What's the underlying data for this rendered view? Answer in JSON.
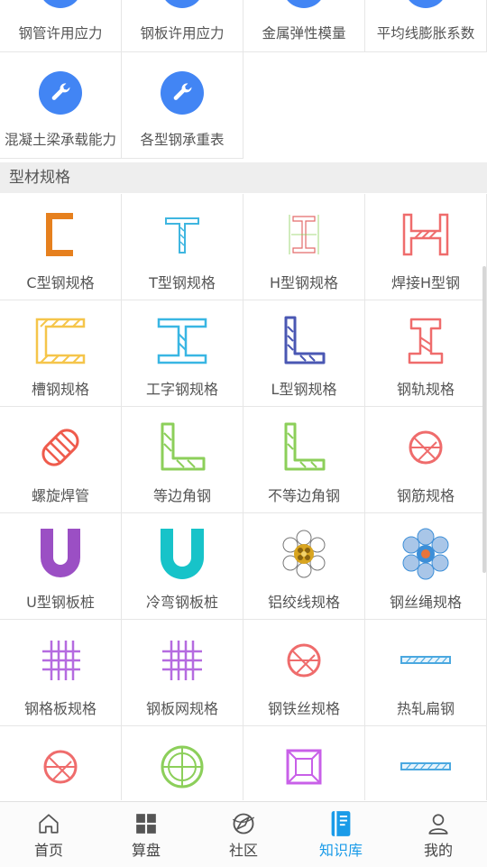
{
  "top_tools": [
    {
      "label": "钢管许用应力",
      "icon": "wrench-icon"
    },
    {
      "label": "钢板许用应力",
      "icon": "wrench-icon"
    },
    {
      "label": "金属弹性模量",
      "icon": "wrench-icon"
    },
    {
      "label": "平均线膨胀系数",
      "icon": "wrench-icon"
    },
    {
      "label": "混凝土梁承载能力",
      "icon": "wrench-icon"
    },
    {
      "label": "各型钢承重表",
      "icon": "wrench-icon"
    }
  ],
  "section": {
    "title": "型材规格"
  },
  "profiles": [
    {
      "label": "C型钢规格",
      "icon": "c-channel-icon",
      "color": "#e6801e"
    },
    {
      "label": "T型钢规格",
      "icon": "t-beam-icon",
      "color": "#3fb6e0"
    },
    {
      "label": "H型钢规格",
      "icon": "h-beam-drawing-icon",
      "color": "#e36b6b"
    },
    {
      "label": "焊接H型钢",
      "icon": "welded-h-beam-icon",
      "color": "#ef6c6c"
    },
    {
      "label": "槽钢规格",
      "icon": "channel-steel-icon",
      "color": "#f5c54a"
    },
    {
      "label": "工字钢规格",
      "icon": "i-beam-icon",
      "color": "#39b6e3"
    },
    {
      "label": "L型钢规格",
      "icon": "l-angle-icon",
      "color": "#4a57b3"
    },
    {
      "label": "钢轨规格",
      "icon": "rail-icon",
      "color": "#ef6c6c"
    },
    {
      "label": "螺旋焊管",
      "icon": "spiral-pipe-icon",
      "color": "#ef5b4c"
    },
    {
      "label": "等边角钢",
      "icon": "equal-angle-icon",
      "color": "#8ccf5a"
    },
    {
      "label": "不等边角钢",
      "icon": "unequal-angle-icon",
      "color": "#8ccf5a"
    },
    {
      "label": "钢筋规格",
      "icon": "rebar-icon",
      "color": "#ef6c6c"
    },
    {
      "label": "U型钢板桩",
      "icon": "u-sheet-pile-icon",
      "color": "#9b4fc4"
    },
    {
      "label": "冷弯钢板桩",
      "icon": "cold-formed-pile-icon",
      "color": "#17c3c9"
    },
    {
      "label": "铝绞线规格",
      "icon": "aluminum-strand-icon",
      "color": "#d9a520"
    },
    {
      "label": "钢丝绳规格",
      "icon": "wire-rope-icon",
      "color": "#3d8fd8"
    },
    {
      "label": "钢格板规格",
      "icon": "grating-icon",
      "color": "#b56be0"
    },
    {
      "label": "钢板网规格",
      "icon": "mesh-icon",
      "color": "#b56be0"
    },
    {
      "label": "钢铁丝规格",
      "icon": "steel-wire-icon",
      "color": "#ef6c6c"
    },
    {
      "label": "热轧扁钢",
      "icon": "flat-bar-icon",
      "color": "#4aa8e0"
    },
    {
      "label": "",
      "icon": "round-bar-icon",
      "color": "#ef6c6c"
    },
    {
      "label": "",
      "icon": "round-pipe-icon",
      "color": "#8ccf5a"
    },
    {
      "label": "",
      "icon": "square-pipe-icon",
      "color": "#c860e8"
    },
    {
      "label": "",
      "icon": "flat-strip-icon",
      "color": "#4aa8e0"
    }
  ],
  "tabs": [
    {
      "label": "首页",
      "icon": "home-icon",
      "active": false
    },
    {
      "label": "算盘",
      "icon": "grid-icon",
      "active": false
    },
    {
      "label": "社区",
      "icon": "compass-icon",
      "active": false
    },
    {
      "label": "知识库",
      "icon": "book-icon",
      "active": true
    },
    {
      "label": "我的",
      "icon": "user-icon",
      "active": false
    }
  ],
  "colors": {
    "accent": "#1a9be8",
    "tool_blue": "#4285f4",
    "section_bg": "#eeeeee"
  }
}
